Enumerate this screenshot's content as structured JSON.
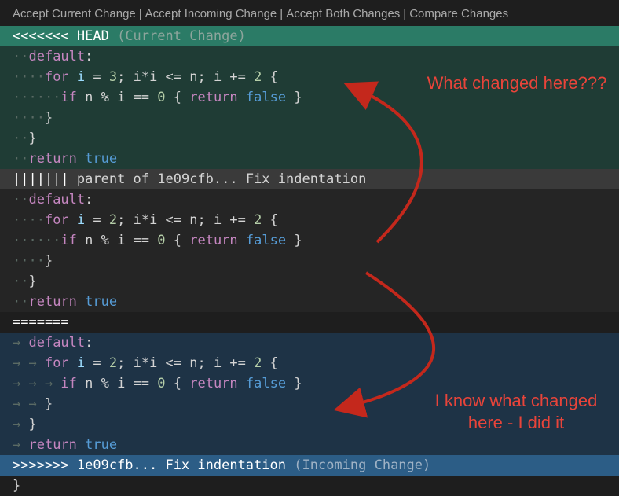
{
  "codelens": {
    "accept_current": "Accept Current Change",
    "accept_incoming": "Accept Incoming Change",
    "accept_both": "Accept Both Changes",
    "compare": "Compare Changes",
    "separator": "|"
  },
  "current": {
    "marker": "<<<<<<< HEAD",
    "hint": "(Current Change)",
    "lines": [
      {
        "indent": "··",
        "tokens": [
          [
            "kw",
            "default"
          ],
          [
            "op",
            ":"
          ]
        ]
      },
      {
        "indent": "····",
        "tokens": [
          [
            "ctl",
            "for"
          ],
          [
            "op",
            " "
          ],
          [
            "var",
            "i"
          ],
          [
            "op",
            " = "
          ],
          [
            "num",
            "3"
          ],
          [
            "op",
            "; i*i <= n; i += "
          ],
          [
            "num",
            "2"
          ],
          [
            "op",
            " {"
          ]
        ]
      },
      {
        "indent": "······",
        "tokens": [
          [
            "ctl",
            "if"
          ],
          [
            "op",
            " n % i == "
          ],
          [
            "num",
            "0"
          ],
          [
            "op",
            " { "
          ],
          [
            "ctl",
            "return"
          ],
          [
            "op",
            " "
          ],
          [
            "bool",
            "false"
          ],
          [
            "op",
            " }"
          ]
        ]
      },
      {
        "indent": "····",
        "tokens": [
          [
            "op",
            "}"
          ]
        ]
      },
      {
        "indent": "··",
        "tokens": [
          [
            "op",
            "}"
          ]
        ]
      },
      {
        "indent": "··",
        "tokens": [
          [
            "ctl",
            "return"
          ],
          [
            "op",
            " "
          ],
          [
            "bool",
            "true"
          ]
        ]
      }
    ]
  },
  "base": {
    "marker": "|||||||",
    "hint": "parent of 1e09cfb... Fix indentation",
    "lines": [
      {
        "indent": "··",
        "tokens": [
          [
            "kw",
            "default"
          ],
          [
            "op",
            ":"
          ]
        ]
      },
      {
        "indent": "····",
        "tokens": [
          [
            "ctl",
            "for"
          ],
          [
            "op",
            " "
          ],
          [
            "var",
            "i"
          ],
          [
            "op",
            " = "
          ],
          [
            "num",
            "2"
          ],
          [
            "op",
            "; i*i <= n; i += "
          ],
          [
            "num",
            "2"
          ],
          [
            "op",
            " {"
          ]
        ]
      },
      {
        "indent": "······",
        "tokens": [
          [
            "ctl",
            "if"
          ],
          [
            "op",
            " n % i == "
          ],
          [
            "num",
            "0"
          ],
          [
            "op",
            " { "
          ],
          [
            "ctl",
            "return"
          ],
          [
            "op",
            " "
          ],
          [
            "bool",
            "false"
          ],
          [
            "op",
            " }"
          ]
        ]
      },
      {
        "indent": "····",
        "tokens": [
          [
            "op",
            "}"
          ]
        ]
      },
      {
        "indent": "··",
        "tokens": [
          [
            "op",
            "}"
          ]
        ]
      },
      {
        "indent": "··",
        "tokens": [
          [
            "ctl",
            "return"
          ],
          [
            "op",
            " "
          ],
          [
            "bool",
            "true"
          ]
        ]
      }
    ]
  },
  "separator": "=======",
  "incoming": {
    "marker": ">>>>>>> 1e09cfb... Fix indentation",
    "hint": "(Incoming Change)",
    "lines": [
      {
        "indent": "→ ",
        "tokens": [
          [
            "kw",
            "default"
          ],
          [
            "op",
            ":"
          ]
        ]
      },
      {
        "indent": "→ → ",
        "tokens": [
          [
            "ctl",
            "for"
          ],
          [
            "op",
            " "
          ],
          [
            "var",
            "i"
          ],
          [
            "op",
            " = "
          ],
          [
            "num",
            "2"
          ],
          [
            "op",
            "; i*i <= n; i += "
          ],
          [
            "num",
            "2"
          ],
          [
            "op",
            " {"
          ]
        ]
      },
      {
        "indent": "→ → → ",
        "tokens": [
          [
            "ctl",
            "if"
          ],
          [
            "op",
            " n % i == "
          ],
          [
            "num",
            "0"
          ],
          [
            "op",
            " { "
          ],
          [
            "ctl",
            "return"
          ],
          [
            "op",
            " "
          ],
          [
            "bool",
            "false"
          ],
          [
            "op",
            " }"
          ]
        ]
      },
      {
        "indent": "→ → ",
        "tokens": [
          [
            "op",
            "}"
          ]
        ]
      },
      {
        "indent": "→ ",
        "tokens": [
          [
            "op",
            "}"
          ]
        ]
      },
      {
        "indent": "→ ",
        "tokens": [
          [
            "ctl",
            "return"
          ],
          [
            "op",
            " "
          ],
          [
            "bool",
            "true"
          ]
        ]
      }
    ]
  },
  "trailing_line": "}",
  "annotations": {
    "top": "What changed here???",
    "bottom_line1": "I know what changed",
    "bottom_line2": "here - I did it",
    "color": "#e8443a"
  },
  "colors": {
    "current_header": "#2b7b66",
    "current_body": "#1f3c35",
    "base_header": "#3a3a3a",
    "base_body": "#252525",
    "incoming_body": "#1e3346",
    "incoming_header": "#2c5d86"
  }
}
